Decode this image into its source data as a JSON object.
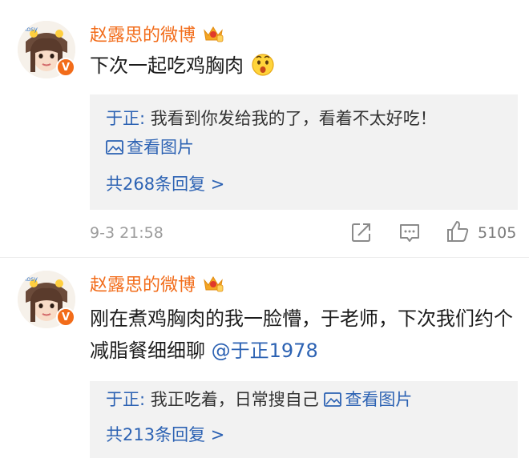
{
  "comments": [
    {
      "username": "赵露思的微博",
      "text": "下次一起吃鸡胸肉",
      "reply": {
        "author": "于正:",
        "text": " 我看到你发给我的了，看着不太好吃！",
        "view_picture": "查看图片"
      },
      "more_replies": "共268条回复 >",
      "timestamp": "9-3 21:58",
      "likes": "5105"
    },
    {
      "username": "赵露思的微博",
      "text": "刚在煮鸡胸肉的我一脸懵，于老师，下次我们约个减脂餐细细聊 ",
      "mention": "@于正1978",
      "reply": {
        "author": "于正:",
        "text": " 我正吃着，日常搜自己 ",
        "view_picture": "查看图片"
      },
      "more_replies": "共213条回复 >"
    }
  ],
  "colors": {
    "username": "#f26c1a",
    "link": "#2c62b3",
    "reply_bg": "#f2f2f2",
    "meta": "#9b9b9b"
  },
  "icons": [
    "avatar",
    "verified-badge-icon",
    "crown-membership-icon",
    "emoji-icon",
    "picture-icon",
    "share-icon",
    "comment-icon",
    "like-icon"
  ]
}
